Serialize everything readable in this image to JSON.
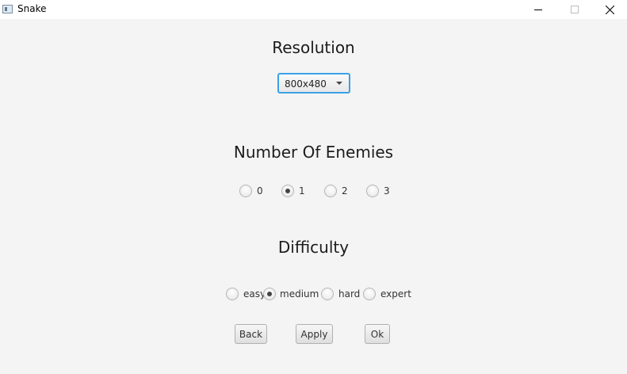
{
  "window": {
    "title": "Snake",
    "icons": {
      "app": "window-app-icon",
      "minimize": "minimize-icon",
      "maximize": "maximize-icon",
      "close": "close-icon"
    }
  },
  "resolution": {
    "title": "Resolution",
    "selected": "800x480"
  },
  "enemies": {
    "title": "Number Of Enemies",
    "options": [
      "0",
      "1",
      "2",
      "3"
    ],
    "selected": "1"
  },
  "difficulty": {
    "title": "Difficulty",
    "options": [
      "easy",
      "medium",
      "hard",
      "expert"
    ],
    "selected": "medium"
  },
  "buttons": {
    "back": "Back",
    "apply": "Apply",
    "ok": "Ok"
  },
  "colors": {
    "background": "#f4f4f4",
    "focus_border": "#3aa1e6"
  }
}
